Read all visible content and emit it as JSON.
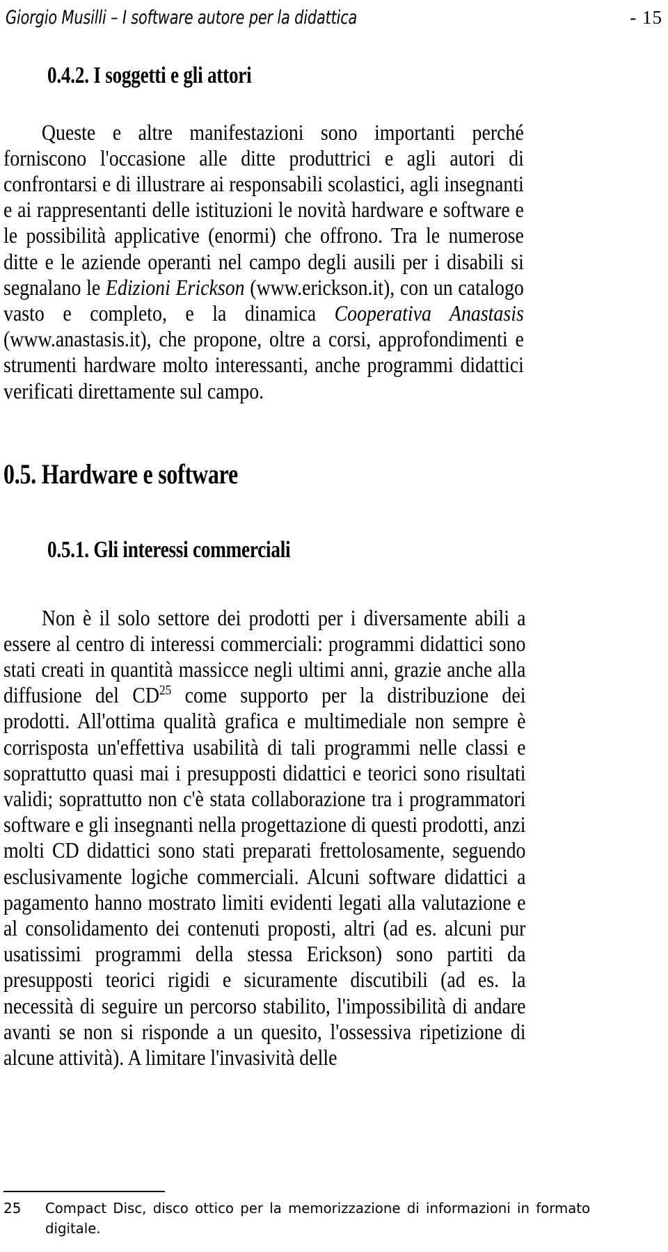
{
  "header": {
    "author_smallcaps_g": "G",
    "author": "Giorgio Musilli",
    "title_full": "Giorgio Musilli – I software autore per la didattica",
    "page_label": "- 15"
  },
  "sections": {
    "s_0_4_2": {
      "number": "0.4.2.",
      "title": "I soggetti e gli attori",
      "heading": "0.4.2. I soggetti e gli attori"
    },
    "s_0_5": {
      "number": "0.5.",
      "title": "Hardware e software",
      "heading": "0.5. Hardware e software"
    },
    "s_0_5_1": {
      "number": "0.5.1.",
      "title": "Gli interessi commerciali",
      "heading": "0.5.1. Gli interessi commerciali"
    }
  },
  "paragraphs": {
    "p1": {
      "part1": "Queste e altre manifestazioni sono importanti perché forniscono l'occasione alle ditte produttrici e agli autori di confrontarsi e di illustrare ai responsabili scolastici, agli insegnanti e ai rappresentanti delle istituzioni le novità hardware e software e le possibilità applicative (enormi) che offrono. Tra le numerose ditte e le aziende operanti nel campo degli ausili per i disabili si segnalano le ",
      "italic1": "Edizioni Erickson",
      "part2": " (www.erickson.it), con un catalogo vasto e completo, e la dinamica ",
      "italic2": "Cooperativa Anastasis",
      "part3": " (www.anastasis.it), che propone, oltre a corsi, approfondimenti e strumenti hardware molto interessanti, anche programmi didattici verificati direttamente sul campo."
    },
    "p2": {
      "part1": "Non è il solo settore dei prodotti per i diversamente abili a essere al centro di interessi commerciali: programmi didattici sono stati creati in quantità massicce negli ultimi anni, grazie anche alla diffusione del CD",
      "footnote_marker": "25",
      "part2": " come supporto per la distribuzione dei prodotti. All'ottima qualità grafica e multimediale non sempre è corrisposta un'effettiva usabilità di tali programmi nelle classi e soprattutto quasi mai i presupposti didattici e teorici sono risultati validi; soprattutto non c'è stata collaborazione tra i programmatori software e gli insegnanti nella progettazione di questi prodotti, anzi molti CD didattici sono stati preparati frettolosamente, seguendo esclusivamente logiche commerciali. Alcuni software didattici a pagamento hanno mostrato limiti evidenti legati alla valutazione e al consolidamento dei contenuti proposti, altri (ad es. alcuni pur usatissimi programmi della stessa Erickson) sono partiti da presupposti teorici rigidi e sicuramente discutibili (ad es. la necessità di seguire un percorso stabilito, l'impossibilità di andare avanti se non si risponde a un quesito, l'ossessiva ripetizione di alcune attività). A limitare l'invasività delle"
    }
  },
  "footnote": {
    "number": "25",
    "text": "Compact Disc, disco ottico per la memorizzazione di informazioni in formato digitale."
  }
}
